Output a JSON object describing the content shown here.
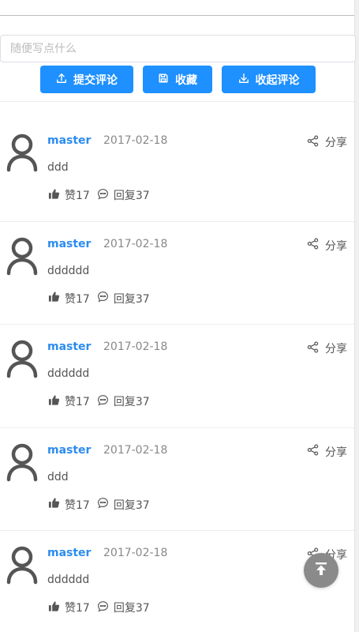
{
  "comment_box": {
    "placeholder": "随便写点什么"
  },
  "toolbar": {
    "submit_label": "提交评论",
    "favorite_label": "收藏",
    "collapse_label": "收起评论"
  },
  "comments": [
    {
      "user": "master",
      "date": "2017-02-18",
      "share": "分享",
      "content": "ddd",
      "like": "赞17",
      "reply": "回复37"
    },
    {
      "user": "master",
      "date": "2017-02-18",
      "share": "分享",
      "content": "dddddd",
      "like": "赞17",
      "reply": "回复37"
    },
    {
      "user": "master",
      "date": "2017-02-18",
      "share": "分享",
      "content": "dddddd",
      "like": "赞17",
      "reply": "回复37"
    },
    {
      "user": "master",
      "date": "2017-02-18",
      "share": "分享",
      "content": "ddd",
      "like": "赞17",
      "reply": "回复37"
    },
    {
      "user": "master",
      "date": "2017-02-18",
      "share": "分享",
      "content": "dddddd",
      "like": "赞17",
      "reply": "回复37"
    }
  ],
  "colors": {
    "primary": "#1e90ff",
    "username": "#2d8cf0",
    "back_to_top": "#8a8a8a"
  },
  "icons": {
    "submit": "upload-icon",
    "favorite": "save-icon",
    "collapse": "download-icon",
    "share": "share-icon",
    "like": "thumbs-up-icon",
    "reply": "chat-bubble-icon",
    "avatar": "user-avatar-icon",
    "back_to_top": "back-to-top-icon"
  }
}
